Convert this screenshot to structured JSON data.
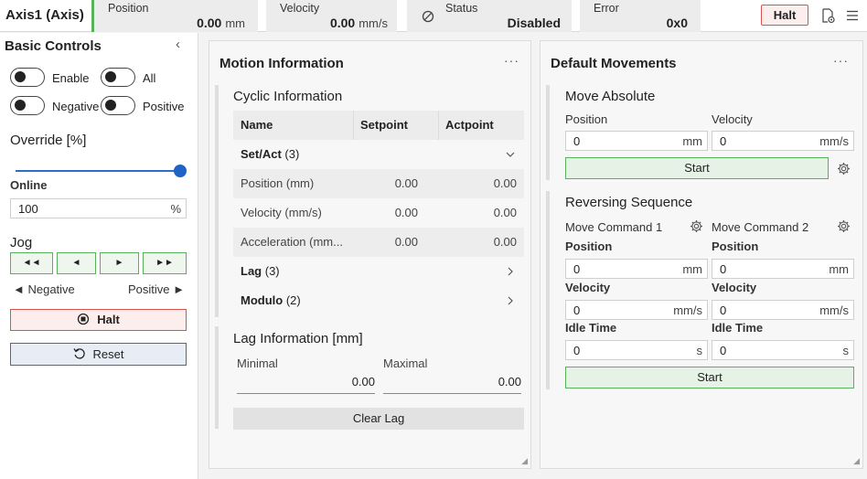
{
  "header": {
    "title": "Axis1 (Axis)",
    "position": {
      "label": "Position",
      "value": "0.00",
      "unit": "mm"
    },
    "velocity": {
      "label": "Velocity",
      "value": "0.00",
      "unit": "mm/s"
    },
    "status": {
      "label": "Status",
      "value": "Disabled",
      "icon": "disabled-icon"
    },
    "error": {
      "label": "Error",
      "value": "0x0"
    },
    "halt_label": "Halt",
    "icons": [
      "document-settings-icon",
      "menu-icon"
    ]
  },
  "sidebar": {
    "title": "Basic Controls",
    "toggles": {
      "enable": "Enable",
      "all": "All",
      "negative": "Negative",
      "positive": "Positive"
    },
    "override_label": "Override [%]",
    "override_slider": 1.0,
    "online_label": "Online",
    "online_value": "100",
    "online_unit": "%",
    "jog_label": "Jog",
    "jog_buttons": [
      "◄◄",
      "◄",
      "►",
      "►►"
    ],
    "jog_negative": "◄ Negative",
    "jog_positive": "Positive ►",
    "halt_label": "Halt",
    "reset_label": "Reset"
  },
  "motion": {
    "title": "Motion Information",
    "cyclic_title": "Cyclic Information",
    "columns": [
      "Name",
      "Setpoint",
      "Actpoint"
    ],
    "group_setact": {
      "name": "Set/Act",
      "count": "(3)"
    },
    "rows": [
      {
        "name": "Position (mm)",
        "set": "0.00",
        "act": "0.00"
      },
      {
        "name": "Velocity (mm/s)",
        "set": "0.00",
        "act": "0.00"
      },
      {
        "name": "Acceleration (mm...",
        "set": "0.00",
        "act": "0.00"
      }
    ],
    "group_lag": {
      "name": "Lag",
      "count": "(3)"
    },
    "group_modulo": {
      "name": "Modulo",
      "count": "(2)"
    },
    "lag_title": "Lag Information [mm]",
    "minimal_label": "Minimal",
    "minimal_value": "0.00",
    "maximal_label": "Maximal",
    "maximal_value": "0.00",
    "clear_lag": "Clear Lag"
  },
  "movements": {
    "title": "Default Movements",
    "move_abs": {
      "title": "Move Absolute",
      "position_label": "Position",
      "position_value": "0",
      "position_unit": "mm",
      "velocity_label": "Velocity",
      "velocity_value": "0",
      "velocity_unit": "mm/s",
      "start": "Start"
    },
    "reversing": {
      "title": "Reversing Sequence",
      "cmd1": "Move Command 1",
      "cmd2": "Move Command 2",
      "position_label": "Position",
      "velocity_label": "Velocity",
      "idle_label": "Idle Time",
      "pos1": "0",
      "pos2": "0",
      "pos_unit": "mm",
      "vel1": "0",
      "vel2": "0",
      "vel_unit": "mm/s",
      "idle1": "0",
      "idle2": "0",
      "idle_unit": "s",
      "start": "Start"
    }
  }
}
